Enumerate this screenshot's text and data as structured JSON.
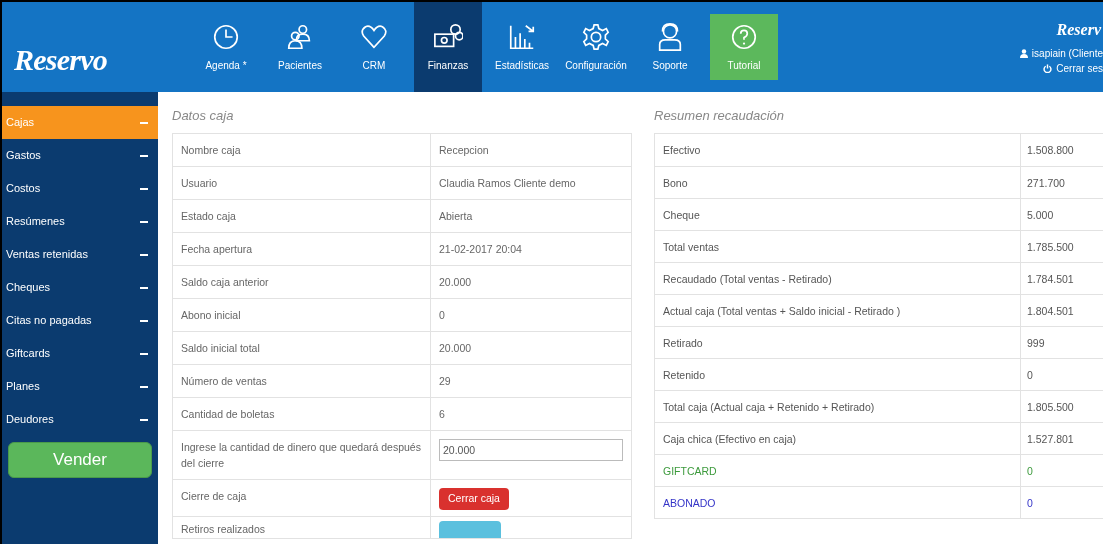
{
  "logo": "Reservo",
  "nav": [
    {
      "label": "Agenda *",
      "selected": false,
      "kind": "plain"
    },
    {
      "label": "Pacientes",
      "selected": false,
      "kind": "plain"
    },
    {
      "label": "CRM",
      "selected": false,
      "kind": "plain"
    },
    {
      "label": "Finanzas",
      "selected": true,
      "kind": "plain"
    },
    {
      "label": "Estadísticas",
      "selected": false,
      "kind": "plain"
    },
    {
      "label": "Configuración",
      "selected": false,
      "kind": "plain"
    },
    {
      "label": "Soporte",
      "selected": false,
      "kind": "plain"
    },
    {
      "label": "Tutorial",
      "selected": false,
      "kind": "highlight"
    }
  ],
  "account": {
    "brand": "Reserv",
    "user": "isapiain (Cliente",
    "logout": "Cerrar ses"
  },
  "sidebar": {
    "items": [
      {
        "label": "Cajas",
        "selected": true
      },
      {
        "label": "Gastos",
        "selected": false
      },
      {
        "label": "Costos",
        "selected": false
      },
      {
        "label": "Resúmenes",
        "selected": false
      },
      {
        "label": "Ventas retenidas",
        "selected": false
      },
      {
        "label": "Cheques",
        "selected": false
      },
      {
        "label": "Citas no pagadas",
        "selected": false
      },
      {
        "label": "Giftcards",
        "selected": false
      },
      {
        "label": "Planes",
        "selected": false
      },
      {
        "label": "Deudores",
        "selected": false
      }
    ],
    "button": "Vender"
  },
  "datos_caja": {
    "title": "Datos caja",
    "rows": [
      {
        "kind": "text",
        "label": "Nombre caja",
        "value": "Recepcion"
      },
      {
        "kind": "text",
        "label": "Usuario",
        "value": "Claudia Ramos Cliente demo"
      },
      {
        "kind": "text",
        "label": "Estado caja",
        "value": "Abierta"
      },
      {
        "kind": "text",
        "label": "Fecha apertura",
        "value": "21-02-2017 20:04"
      },
      {
        "kind": "text",
        "label": "Saldo caja anterior",
        "value": "20.000"
      },
      {
        "kind": "text",
        "label": "Abono inicial",
        "value": "0"
      },
      {
        "kind": "text",
        "label": "Saldo inicial total",
        "value": "20.000"
      },
      {
        "kind": "text",
        "label": "Número de ventas",
        "value": "29"
      },
      {
        "kind": "text",
        "label": "Cantidad de boletas",
        "value": "6"
      },
      {
        "kind": "input",
        "label": "Ingrese la cantidad de dinero que quedará después del cierre",
        "value": "20.000"
      },
      {
        "kind": "danger_button",
        "label": "Cierre de caja",
        "value": "Cerrar caja"
      },
      {
        "kind": "info_button",
        "label": "Retiros realizados"
      }
    ]
  },
  "resumen": {
    "title": "Resumen recaudación",
    "rows": [
      {
        "label": "Efectivo",
        "value": "1.508.800"
      },
      {
        "label": "Bono",
        "value": "271.700"
      },
      {
        "label": "Cheque",
        "value": "5.000"
      },
      {
        "label": "Total ventas",
        "value": "1.785.500"
      },
      {
        "label": "Recaudado (Total ventas - Retirado)",
        "value": "1.784.501"
      },
      {
        "label": "Actual caja (Total ventas + Saldo inicial - Retirado )",
        "value": "1.804.501"
      },
      {
        "label": "Retirado",
        "value": "999"
      },
      {
        "label": "Retenido",
        "value": "0"
      },
      {
        "label": "Total caja (Actual caja + Retenido + Retirado)",
        "value": "1.805.500"
      },
      {
        "label": "Caja chica (Efectivo en caja)",
        "value": "1.527.801"
      },
      {
        "label": "GIFTCARD",
        "value": "0",
        "color": "#3c9a3c"
      },
      {
        "label": "ABONADO",
        "value": "0",
        "color": "#3535c8"
      }
    ]
  }
}
